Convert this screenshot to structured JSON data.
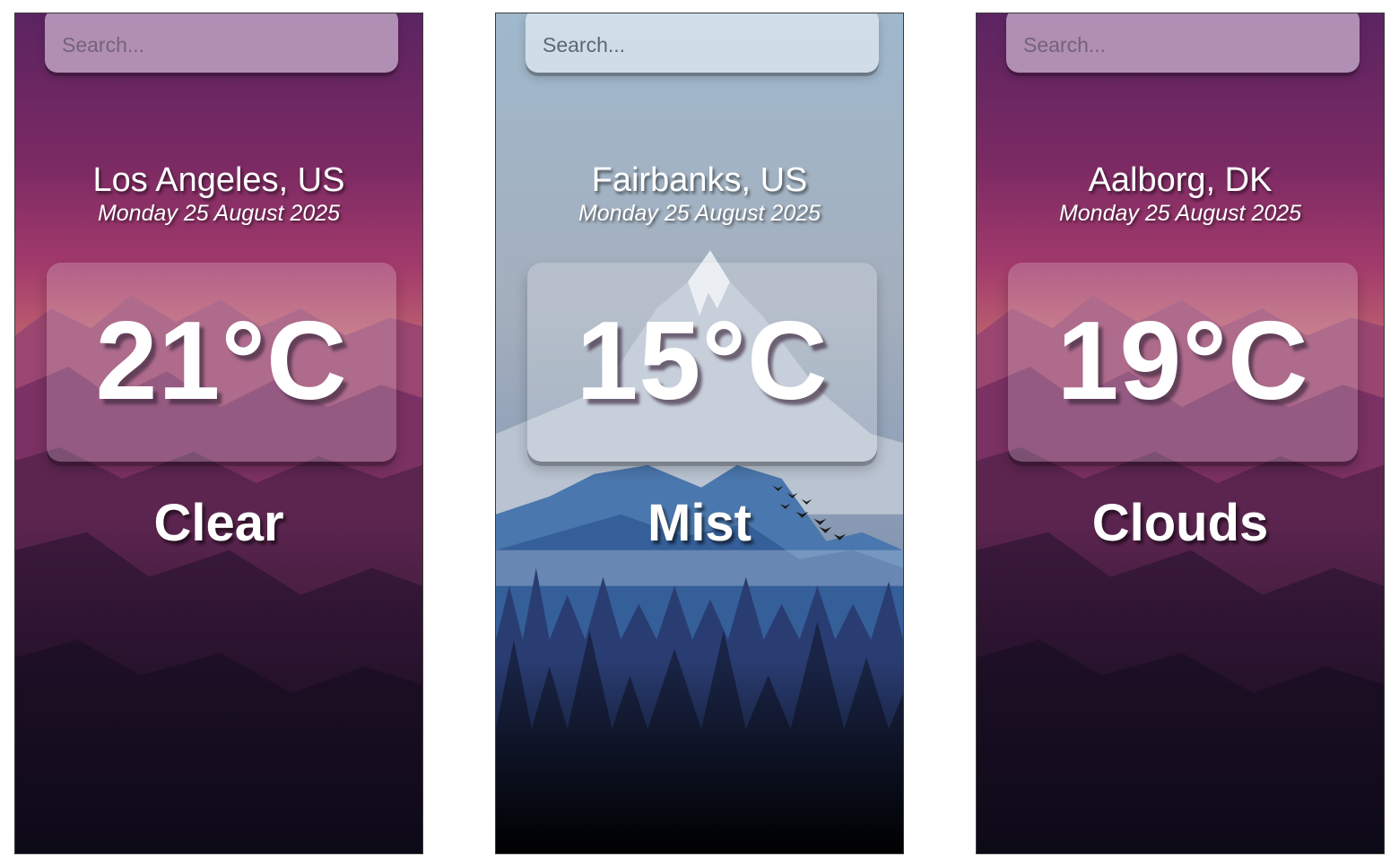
{
  "cards": [
    {
      "theme": "dusk",
      "search_placeholder": "Search...",
      "location": "Los Angeles, US",
      "date": "Monday 25 August 2025",
      "temperature": "21°C",
      "condition": "Clear"
    },
    {
      "theme": "mist",
      "search_placeholder": "Search...",
      "location": "Fairbanks, US",
      "date": "Monday 25 August 2025",
      "temperature": "15°C",
      "condition": "Mist"
    },
    {
      "theme": "dusk",
      "search_placeholder": "Search...",
      "location": "Aalborg, DK",
      "date": "Monday 25 August 2025",
      "temperature": "19°C",
      "condition": "Clouds"
    }
  ],
  "colors": {
    "dusk_sky_top": "#5b2462",
    "dusk_sky_mid": "#a23a6c",
    "dusk_glow": "#d58b73",
    "dusk_bottom": "#0b0916",
    "mist_sky_top": "#9fb8cc",
    "mist_mountain": "#3f6aa3",
    "mist_forest": "#1c2a55",
    "mist_bottom": "#000000",
    "text": "#ffffff"
  }
}
